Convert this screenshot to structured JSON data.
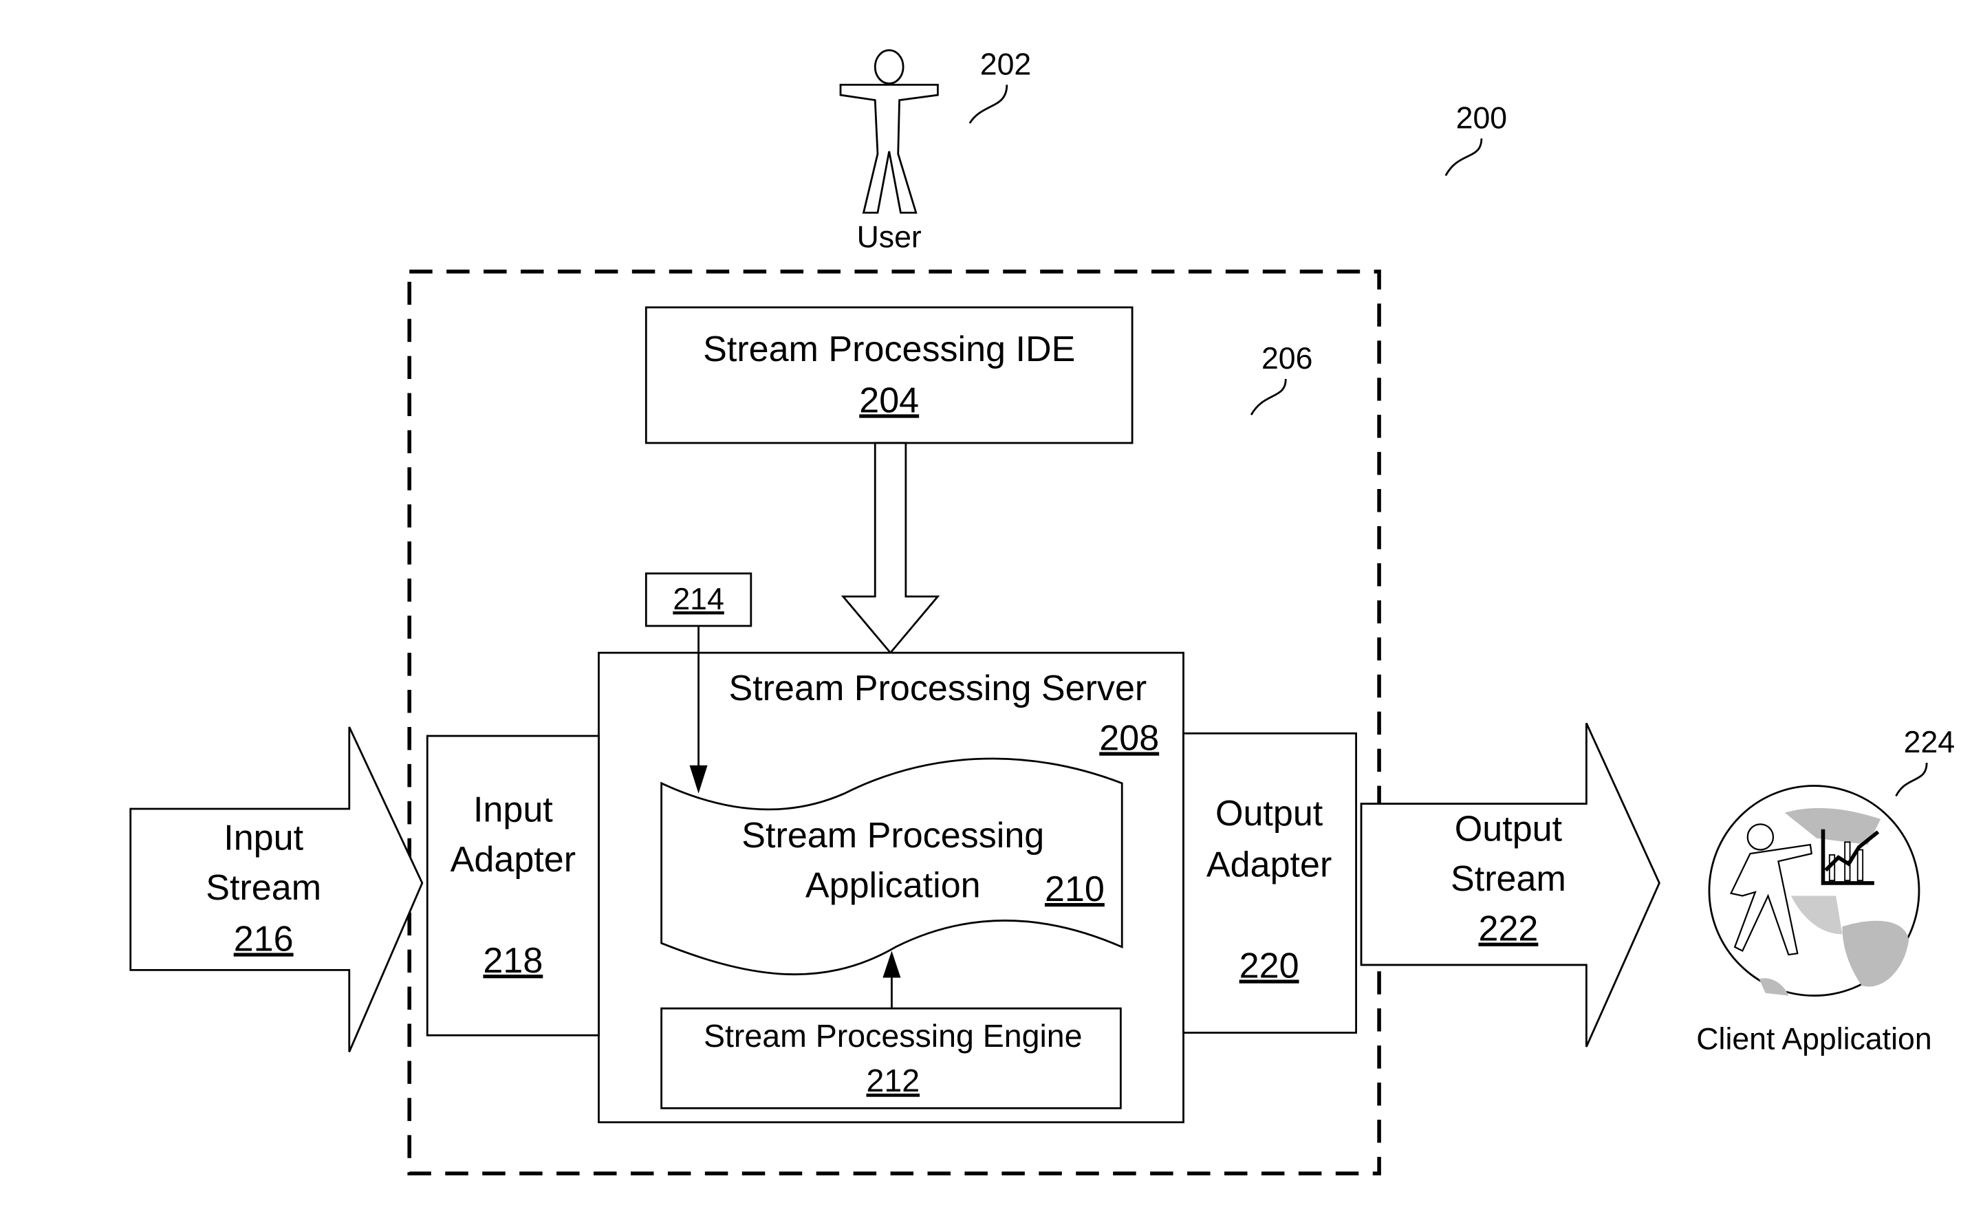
{
  "figure_number": "200",
  "user": {
    "label": "User",
    "ref": "202"
  },
  "system": {
    "ref": "206"
  },
  "ide": {
    "label": "Stream Processing IDE",
    "ref": "204"
  },
  "server": {
    "label": "Stream Processing Server",
    "ref": "208"
  },
  "application": {
    "line1": "Stream Processing",
    "line2": "Application",
    "ref": "210"
  },
  "engine": {
    "label": "Stream Processing Engine",
    "ref": "212"
  },
  "config": {
    "ref": "214"
  },
  "input_stream": {
    "line1": "Input",
    "line2": "Stream",
    "ref": "216"
  },
  "input_adapter": {
    "line1": "Input",
    "line2": "Adapter",
    "ref": "218"
  },
  "output_adapter": {
    "line1": "Output",
    "line2": "Adapter",
    "ref": "220"
  },
  "output_stream": {
    "line1": "Output",
    "line2": "Stream",
    "ref": "222"
  },
  "client": {
    "label": "Client Application",
    "ref": "224"
  }
}
